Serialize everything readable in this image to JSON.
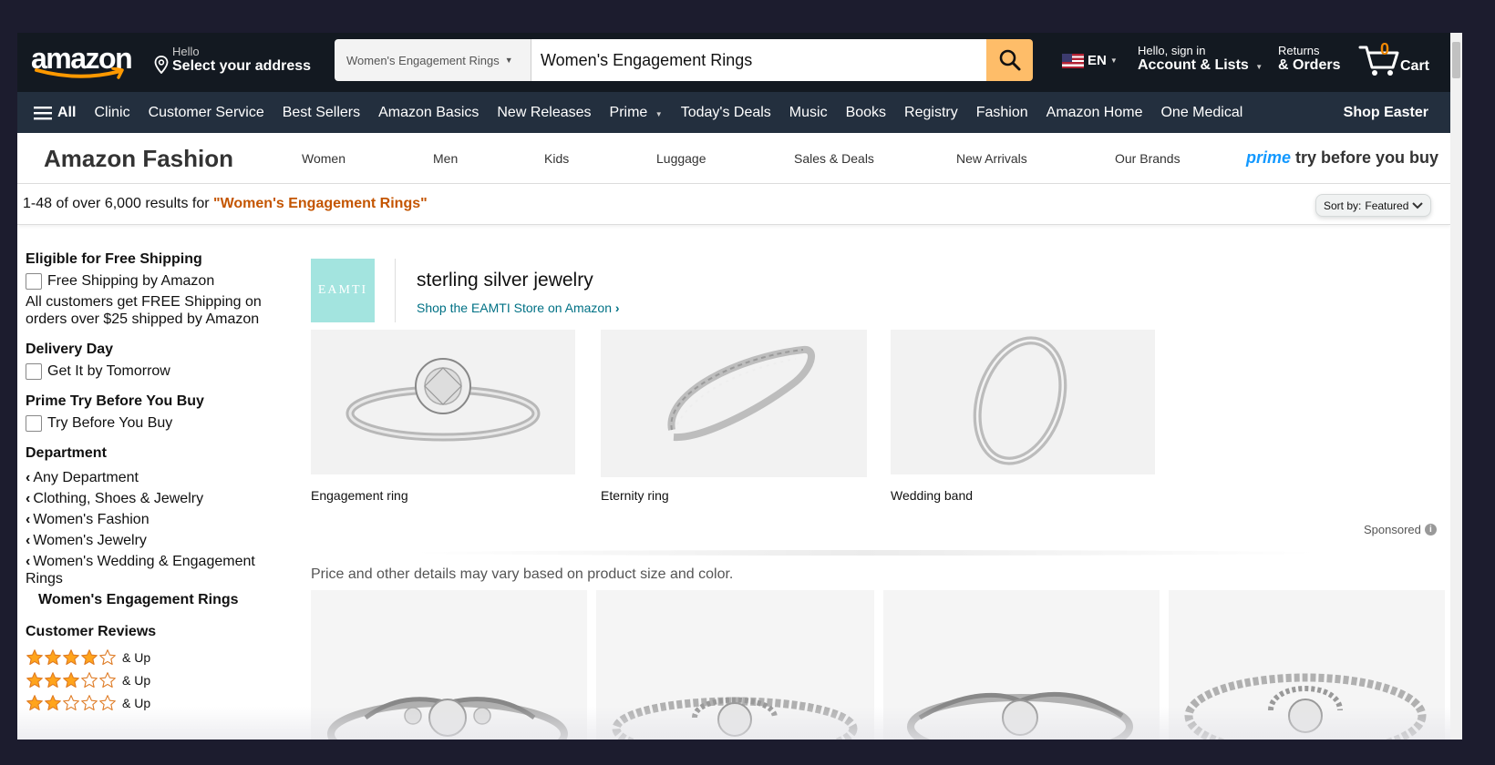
{
  "header": {
    "logo": "amazon",
    "deliver_line1": "Hello",
    "deliver_line2": "Select your address",
    "search_category": "Women's Engagement Rings",
    "search_value": "Women's Engagement Rings",
    "language": "EN",
    "account_line1": "Hello, sign in",
    "account_line2": "Account & Lists",
    "orders_line1": "Returns",
    "orders_line2": "& Orders",
    "cart_count": "0",
    "cart_label": "Cart"
  },
  "subnav": {
    "all_label": "All",
    "items": [
      "Clinic",
      "Customer Service",
      "Best Sellers",
      "Amazon Basics",
      "New Releases",
      "Prime",
      "Today's Deals",
      "Music",
      "Books",
      "Registry",
      "Fashion",
      "Amazon Home",
      "One Medical"
    ],
    "promo": "Shop Easter"
  },
  "fashion": {
    "brand": "Amazon Fashion",
    "items": [
      "Women",
      "Men",
      "Kids",
      "Luggage",
      "Sales & Deals",
      "New Arrivals",
      "Our Brands"
    ],
    "prime_word": "prime",
    "prime_tagline": "try before you buy"
  },
  "results": {
    "prefix": "1-48 of over 6,000 results for ",
    "query": "\"Women's Engagement Rings\"",
    "sort_label": "Sort by:",
    "sort_value": "Featured"
  },
  "sidebar": {
    "shipping_heading": "Eligible for Free Shipping",
    "shipping_option": "Free Shipping by Amazon",
    "shipping_note": "All customers get FREE Shipping on orders over $25 shipped by Amazon",
    "delivery_heading": "Delivery Day",
    "delivery_option": "Get It by Tomorrow",
    "prime_heading": "Prime Try Before You Buy",
    "prime_option": "Try Before You Buy",
    "department_heading": "Department",
    "departments": [
      "Any Department",
      "Clothing, Shoes & Jewelry",
      "Women's Fashion",
      "Women's Jewelry",
      "Women's Wedding & Engagement Rings"
    ],
    "current_department": "Women's Engagement Rings",
    "reviews_heading": "Customer Reviews",
    "review_levels": [
      {
        "stars": 4,
        "label": "& Up"
      },
      {
        "stars": 3,
        "label": "& Up"
      },
      {
        "stars": 2,
        "label": "& Up"
      }
    ]
  },
  "sponsored_ad": {
    "brand_logo": "EAMTI",
    "headline": "sterling silver jewelry",
    "store_link": "Shop the EAMTI Store on Amazon",
    "tiles": [
      "Engagement ring",
      "Eternity ring",
      "Wedding band"
    ],
    "sponsored_label": "Sponsored"
  },
  "main": {
    "disclaimer": "Price and other details may vary based on product size and color."
  },
  "colors": {
    "nav_dark": "#131921",
    "nav_sub": "#232f3e",
    "search_button": "#febd69",
    "cart_count": "#f08804",
    "query_orange": "#c45500",
    "link_teal": "#007185",
    "star": "#ffa41c"
  }
}
